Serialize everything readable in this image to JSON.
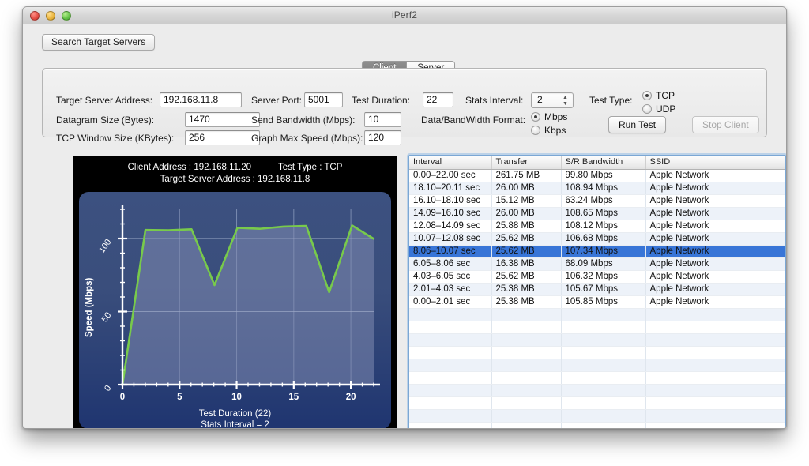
{
  "window": {
    "title": "iPerf2",
    "traffic_lights": [
      "close",
      "minimize",
      "zoom"
    ]
  },
  "toolbar": {
    "search_servers_label": "Search Target Servers"
  },
  "tabs": [
    {
      "label": "Client",
      "active": true
    },
    {
      "label": "Server",
      "active": false
    }
  ],
  "form": {
    "target_server_address": {
      "label": "Target Server Address:",
      "value": "192.168.11.8"
    },
    "server_port": {
      "label": "Server Port:",
      "value": "5001"
    },
    "test_duration": {
      "label": "Test Duration:",
      "value": "22"
    },
    "stats_interval": {
      "label": "Stats Interval:",
      "value": "2"
    },
    "test_type": {
      "label": "Test Type:",
      "options": [
        "TCP",
        "UDP"
      ],
      "selected": "TCP"
    },
    "datagram_size": {
      "label": "Datagram Size (Bytes):",
      "value": "1470"
    },
    "send_bandwidth": {
      "label": "Send Bandwidth (Mbps):",
      "value": "10"
    },
    "data_bandwidth_format": {
      "label": "Data/BandWidth Format:",
      "options": [
        "Mbps",
        "Kbps"
      ],
      "selected": "Mbps"
    },
    "tcp_window_size": {
      "label": "TCP Window Size (KBytes):",
      "value": "256"
    },
    "graph_max_speed": {
      "label": "Graph Max Speed (Mbps):",
      "value": "120"
    },
    "run_test_label": "Run Test",
    "stop_client_label": "Stop Client",
    "stop_client_disabled": true
  },
  "graph": {
    "client_address_label": "Client Address : 192.168.11.20",
    "test_type_label": "Test Type : TCP",
    "target_server_label": "Target Server Address : 192.168.11.8",
    "caption_line1": "Test Duration (22)",
    "caption_line2": "Stats Interval = 2"
  },
  "chart_data": {
    "type": "area",
    "title": "Client Address : 192.168.11.20   Test Type : TCP",
    "subtitle": "Target Server Address : 192.168.11.8",
    "xlabel": "Test Duration (22)",
    "ylabel": "Speed (Mbps)",
    "xlim": [
      0,
      22
    ],
    "ylim": [
      0,
      120
    ],
    "xticks": [
      0,
      5,
      10,
      15,
      20
    ],
    "yticks": [
      0,
      50,
      100
    ],
    "xtick_labels": [
      "0",
      "5",
      "10",
      "15",
      "20"
    ],
    "ytick_labels": [
      "0",
      "50",
      "100"
    ],
    "grid": true,
    "line_color": "#78ca4b",
    "fill_color": "#7f8bb0",
    "background_color": "#31487a",
    "series": [
      {
        "name": "Speed (Mbps)",
        "x": [
          0,
          2.01,
          4.03,
          6.05,
          8.06,
          10.07,
          12.08,
          14.09,
          16.1,
          18.1,
          20.11,
          22.0
        ],
        "y": [
          0,
          105.85,
          105.67,
          106.32,
          68.09,
          107.34,
          106.68,
          108.12,
          108.65,
          63.24,
          108.94,
          99.8
        ]
      }
    ]
  },
  "table": {
    "columns": [
      "Interval",
      "Transfer",
      "S/R Bandwidth",
      "SSID"
    ],
    "rows": [
      {
        "interval": "0.00–22.00 sec",
        "transfer": "261.75 MB",
        "bandwidth": "99.80 Mbps",
        "ssid": "Apple Network",
        "selected": false
      },
      {
        "interval": "18.10–20.11 sec",
        "transfer": "26.00 MB",
        "bandwidth": "108.94 Mbps",
        "ssid": "Apple Network",
        "selected": false
      },
      {
        "interval": "16.10–18.10 sec",
        "transfer": "15.12 MB",
        "bandwidth": "63.24 Mbps",
        "ssid": "Apple Network",
        "selected": false
      },
      {
        "interval": "14.09–16.10 sec",
        "transfer": "26.00 MB",
        "bandwidth": "108.65 Mbps",
        "ssid": "Apple Network",
        "selected": false
      },
      {
        "interval": "12.08–14.09 sec",
        "transfer": "25.88 MB",
        "bandwidth": "108.12 Mbps",
        "ssid": "Apple Network",
        "selected": false
      },
      {
        "interval": "10.07–12.08 sec",
        "transfer": "25.62 MB",
        "bandwidth": "106.68 Mbps",
        "ssid": "Apple Network",
        "selected": false
      },
      {
        "interval": "8.06–10.07 sec",
        "transfer": "25.62 MB",
        "bandwidth": "107.34 Mbps",
        "ssid": "Apple Network",
        "selected": true
      },
      {
        "interval": "6.05–8.06 sec",
        "transfer": "16.38 MB",
        "bandwidth": "68.09 Mbps",
        "ssid": "Apple Network",
        "selected": false
      },
      {
        "interval": "4.03–6.05 sec",
        "transfer": "25.62 MB",
        "bandwidth": "106.32 Mbps",
        "ssid": "Apple Network",
        "selected": false
      },
      {
        "interval": "2.01–4.03 sec",
        "transfer": "25.38 MB",
        "bandwidth": "105.67 Mbps",
        "ssid": "Apple Network",
        "selected": false
      },
      {
        "interval": "0.00–2.01 sec",
        "transfer": "25.38 MB",
        "bandwidth": "105.85 Mbps",
        "ssid": "Apple Network",
        "selected": false
      }
    ],
    "empty_row_count": 11
  }
}
